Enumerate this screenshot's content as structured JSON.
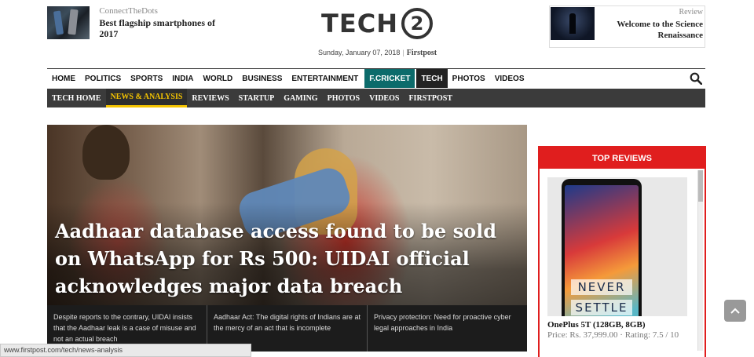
{
  "promo_left": {
    "source": "ConnectTheDots",
    "title": "Best flagship smartphones of 2017"
  },
  "logo": {
    "text": "TECH",
    "number": "2"
  },
  "dateline": {
    "date": "Sunday, January 07, 2018",
    "brand": "Firstpost"
  },
  "promo_right": {
    "source": "Review",
    "title": "Welcome to the Science Renaissance"
  },
  "main_nav": {
    "items": [
      "HOME",
      "POLITICS",
      "SPORTS",
      "INDIA",
      "WORLD",
      "BUSINESS",
      "ENTERTAINMENT",
      "F.CRICKET",
      "TECH",
      "PHOTOS",
      "VIDEOS"
    ],
    "search_icon": "search-icon"
  },
  "sub_nav": {
    "items": [
      "TECH HOME",
      "NEWS & ANALYSIS",
      "REVIEWS",
      "STARTUP",
      "GAMING",
      "PHOTOS",
      "VIDEOS",
      "FIRSTPOST"
    ],
    "active": "NEWS & ANALYSIS",
    "active_color": "#f5c400"
  },
  "hero": {
    "title": "Aadhaar database access found to be sold on WhatsApp for Rs 500: UIDAI official acknowledges major data breach",
    "related": [
      "Despite reports to the contrary, UIDAI insists that the Aadhaar leak is a case of misuse and not an actual breach",
      "Aadhaar Act: The digital rights of Indians are at the mercy of an act that is incomplete",
      "Privacy protection: Need for proactive cyber legal approaches in India"
    ]
  },
  "top_reviews": {
    "header": "TOP REVIEWS",
    "accent": "#e01e1e",
    "item": {
      "name": "OnePlus 5T (128GB, 8GB)",
      "meta": "Price: Rs. 37,999.00 · Rating: 7.5 / 10",
      "screen_line1": "NEVER",
      "screen_line2": "SETTLE"
    }
  },
  "status_bar": {
    "url": "www.firstpost.com/tech/news-analysis"
  }
}
